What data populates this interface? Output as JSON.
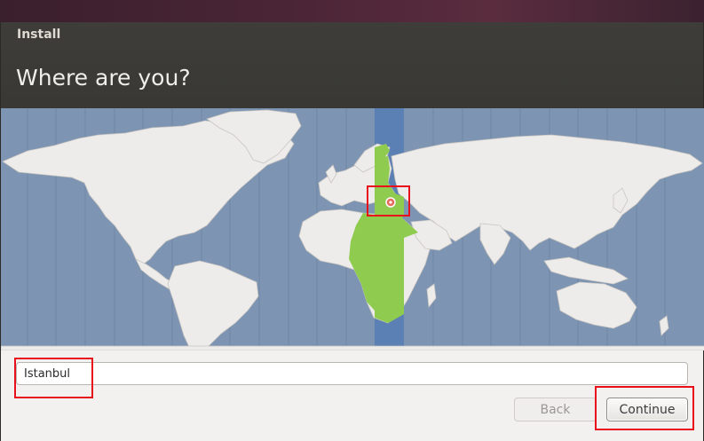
{
  "window": {
    "title": "Install"
  },
  "page": {
    "heading": "Where are you?"
  },
  "map": {
    "selected_marker": "location-pin-icon",
    "colors": {
      "ocean": "#7d94b3",
      "land": "#eeecea",
      "timezone_band": "#5b80b4",
      "selected_zone_land": "#8fcb4f",
      "marker": "#e86a5a"
    }
  },
  "location": {
    "value": "Istanbul"
  },
  "buttons": {
    "back_label": "Back",
    "continue_label": "Continue"
  },
  "annotation": {
    "color": "#e8101a"
  }
}
